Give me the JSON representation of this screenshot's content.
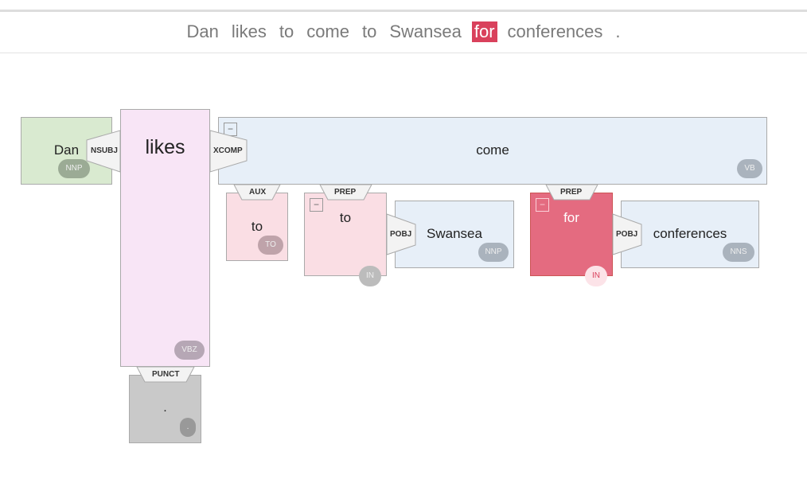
{
  "sentence": {
    "tokens": [
      "Dan",
      "likes",
      "to",
      "come",
      "to",
      "Swansea",
      "for",
      "conferences",
      "."
    ],
    "highlighted_index": 6
  },
  "nodes": {
    "dan": {
      "word": "Dan",
      "tag": "NNP"
    },
    "likes": {
      "word": "likes",
      "tag": "VBZ"
    },
    "period": {
      "word": ".",
      "tag": "."
    },
    "come": {
      "word": "come",
      "tag": "VB"
    },
    "to_aux": {
      "word": "to",
      "tag": "TO"
    },
    "to_prep": {
      "word": "to",
      "tag": "IN"
    },
    "swansea": {
      "word": "Swansea",
      "tag": "NNP"
    },
    "for": {
      "word": "for",
      "tag": "IN"
    },
    "conferences": {
      "word": "conferences",
      "tag": "NNS"
    }
  },
  "relations": {
    "nsubj": "NSUBJ",
    "xcomp": "XCOMP",
    "punct": "PUNCT",
    "aux": "AUX",
    "prep_to": "PREP",
    "pobj_swansea": "POBJ",
    "prep_for": "PREP",
    "pobj_conferences": "POBJ"
  },
  "collapse_symbol": "−",
  "colors": {
    "nnp_green": "#d9ead0",
    "vbz_pink": "#f8e5f6",
    "punct_gray": "#c9c9c9",
    "noun_blue": "#e7eff8",
    "prep_pink": "#fadee4",
    "highlight_red": "#e46b80",
    "highlight_token": "#d9415c"
  }
}
